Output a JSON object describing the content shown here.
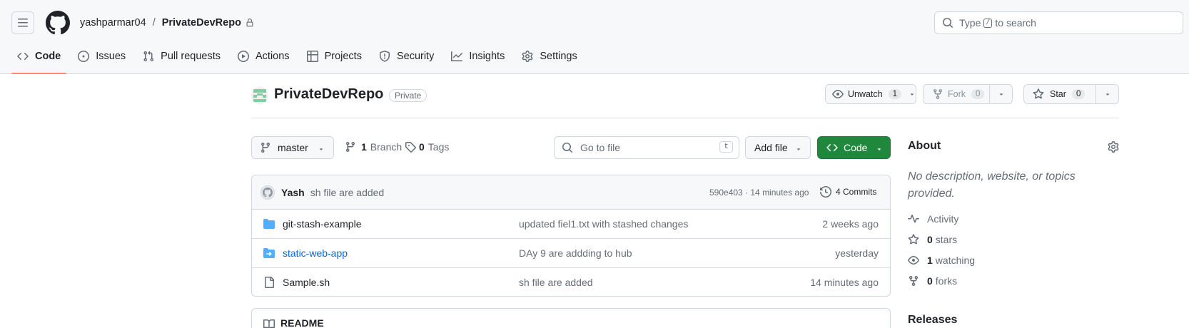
{
  "header": {
    "owner": "yashparmar04",
    "separator": "/",
    "repo": "PrivateDevRepo",
    "search_prefix": "Type",
    "search_key": "/",
    "search_suffix": "to search"
  },
  "tabs": [
    {
      "label": "Code",
      "icon": "code-icon",
      "active": true
    },
    {
      "label": "Issues",
      "icon": "issue-icon"
    },
    {
      "label": "Pull requests",
      "icon": "pull-request-icon"
    },
    {
      "label": "Actions",
      "icon": "play-icon"
    },
    {
      "label": "Projects",
      "icon": "table-icon"
    },
    {
      "label": "Security",
      "icon": "shield-icon"
    },
    {
      "label": "Insights",
      "icon": "graph-icon"
    },
    {
      "label": "Settings",
      "icon": "gear-icon"
    }
  ],
  "repo_head": {
    "title": "PrivateDevRepo",
    "visibility": "Private",
    "unwatch_label": "Unwatch",
    "unwatch_count": "1",
    "fork_label": "Fork",
    "fork_count": "0",
    "star_label": "Star",
    "star_count": "0"
  },
  "toolbar": {
    "branch": "master",
    "branch_count": "1",
    "branch_label": "Branch",
    "tag_count": "0",
    "tag_label": "Tags",
    "goto_placeholder": "Go to file",
    "goto_key": "t",
    "add_file": "Add file",
    "code": "Code"
  },
  "latest_commit": {
    "author": "Yash",
    "message": "sh file are added",
    "sha_time": "590e403 · 14 minutes ago",
    "commits": "4 Commits"
  },
  "files": [
    {
      "name": "git-stash-example",
      "type": "folder",
      "message": "updated fiel1.txt with stashed changes",
      "date": "2 weeks ago"
    },
    {
      "name": "static-web-app",
      "type": "submodule",
      "message": "DAy 9 are addding to hub",
      "date": "yesterday"
    },
    {
      "name": "Sample.sh",
      "type": "file",
      "message": "sh file are added",
      "date": "14 minutes ago"
    }
  ],
  "readme": {
    "title": "README"
  },
  "about": {
    "title": "About",
    "description": "No description, website, or topics provided.",
    "activity": "Activity",
    "stars_count": "0",
    "stars_label": "stars",
    "watching_count": "1",
    "watching_label": "watching",
    "forks_count": "0",
    "forks_label": "forks",
    "releases": "Releases"
  },
  "colors": {
    "accent_green": "#1f883d",
    "link_blue": "#0969da",
    "folder_blue": "#54aeff",
    "active_tab_underline": "#fd8c73"
  }
}
